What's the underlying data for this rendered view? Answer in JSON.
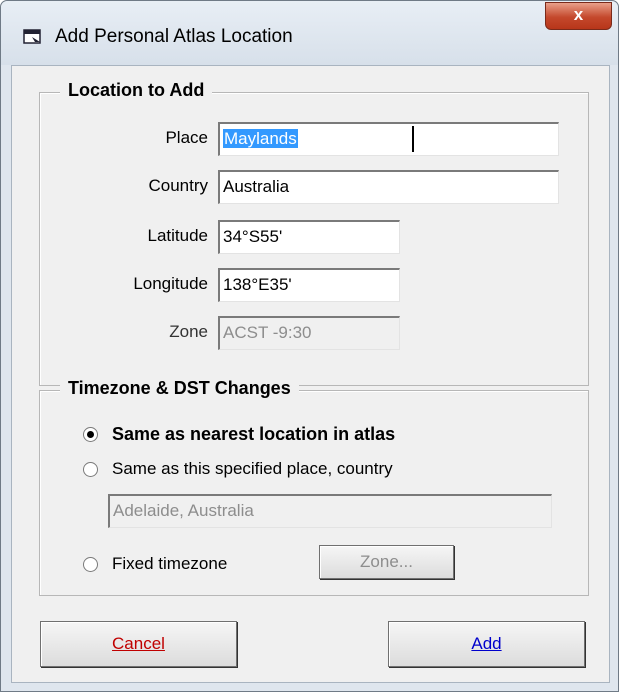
{
  "window": {
    "title": "Add Personal Atlas Location",
    "close_label": "x"
  },
  "location": {
    "group_title": "Location to Add",
    "place_label": "Place",
    "place_value": "Maylands",
    "country_label": "Country",
    "country_value": "Australia",
    "latitude_label": "Latitude",
    "latitude_value": "34°S55'",
    "longitude_label": "Longitude",
    "longitude_value": "138°E35'",
    "zone_label": "Zone",
    "zone_value": "ACST -9:30"
  },
  "timezone": {
    "group_title": "Timezone & DST Changes",
    "option_nearest": "Same as nearest location in atlas",
    "option_specified": "Same as this specified place, country",
    "specified_value": "Adelaide, Australia",
    "option_fixed": "Fixed timezone",
    "zone_button": "Zone...",
    "selected": "nearest"
  },
  "buttons": {
    "cancel": "Cancel",
    "add": "Add"
  },
  "colors": {
    "selection": "#3399ff",
    "cancel_text": "#c00000",
    "add_text": "#0000cc"
  }
}
